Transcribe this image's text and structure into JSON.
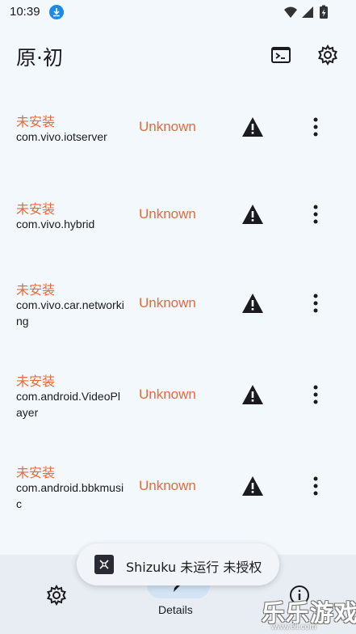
{
  "status_bar": {
    "time": "10:39",
    "icons": [
      "download-icon",
      "wifi-icon",
      "signal-icon",
      "battery-charging-icon"
    ]
  },
  "header": {
    "title": "原·初",
    "actions": [
      "terminal-icon",
      "settings-icon"
    ]
  },
  "apps": [
    {
      "status": "未安装",
      "package": "com.vivo.iotserver",
      "version": "Unknown"
    },
    {
      "status": "未安装",
      "package": "com.vivo.hybrid",
      "version": "Unknown"
    },
    {
      "status": "未安装",
      "package": "com.vivo.car.networking",
      "version": "Unknown"
    },
    {
      "status": "未安装",
      "package": "com.android.VideoPlayer",
      "version": "Unknown"
    },
    {
      "status": "未安装",
      "package": "com.android.bbkmusic",
      "version": "Unknown"
    }
  ],
  "row_icons": [
    "warning-icon",
    "more-vert-icon"
  ],
  "snackbar": {
    "icon": "shizuku-icon",
    "text": "Shizuku 未运行 未授权"
  },
  "bottom_nav": {
    "items": [
      {
        "label": "",
        "icon": "settings-icon"
      },
      {
        "label": "Details",
        "icon": "details-icon",
        "selected": true
      },
      {
        "label": "",
        "icon": "info-icon"
      }
    ]
  },
  "watermark": {
    "text": "乐乐游戏",
    "url": "www.6ll.com"
  },
  "colors": {
    "background": "#f3f8fd",
    "accent_orange": "#e8693c",
    "nav_background": "#e7edf3",
    "nav_selected_pill": "#d3e4f6"
  }
}
